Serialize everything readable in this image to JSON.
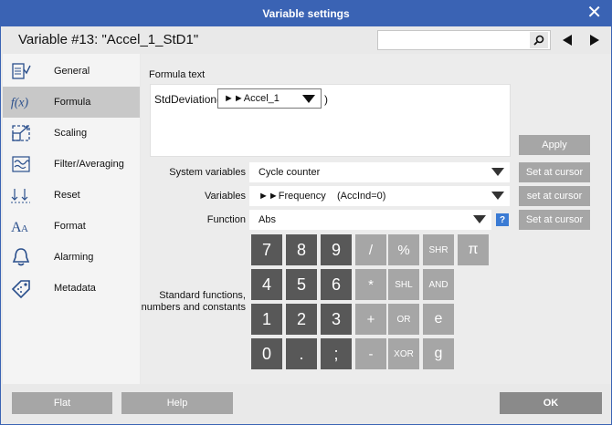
{
  "window": {
    "title": "Variable settings"
  },
  "header": {
    "variable_name": "Variable #13: \"Accel_1_StD1\"",
    "search_value": ""
  },
  "sidebar": {
    "items": [
      {
        "label": "General"
      },
      {
        "label": "Formula"
      },
      {
        "label": "Scaling"
      },
      {
        "label": "Filter/Averaging"
      },
      {
        "label": "Reset"
      },
      {
        "label": "Format"
      },
      {
        "label": "Alarming"
      },
      {
        "label": "Metadata"
      }
    ],
    "active_index": 1
  },
  "formula": {
    "label": "Formula text",
    "function_text": "StdDeviation(",
    "argument": "►►Accel_1",
    "closing": ")",
    "apply_label": "Apply"
  },
  "system_variables": {
    "label": "System variables",
    "value": "Cycle counter",
    "button": "Set at cursor"
  },
  "variables": {
    "label": "Variables",
    "value": "►►Frequency    (AccInd=0)",
    "button": "set at cursor"
  },
  "function": {
    "label": "Function",
    "value": "Abs",
    "help": "?",
    "button": "Set at cursor"
  },
  "keypad": {
    "label": "Standard functions, numbers and constants",
    "rows": [
      [
        "7",
        "8",
        "9",
        "/",
        "%",
        "SHR",
        "π"
      ],
      [
        "4",
        "5",
        "6",
        "*",
        "SHL",
        "AND"
      ],
      [
        "1",
        "2",
        "3",
        "+",
        "OR",
        "e"
      ],
      [
        "0",
        ".",
        ";",
        "-",
        "XOR",
        "g"
      ]
    ]
  },
  "footer": {
    "flat_label": "Flat",
    "help_label": "Help",
    "ok_label": "OK"
  }
}
